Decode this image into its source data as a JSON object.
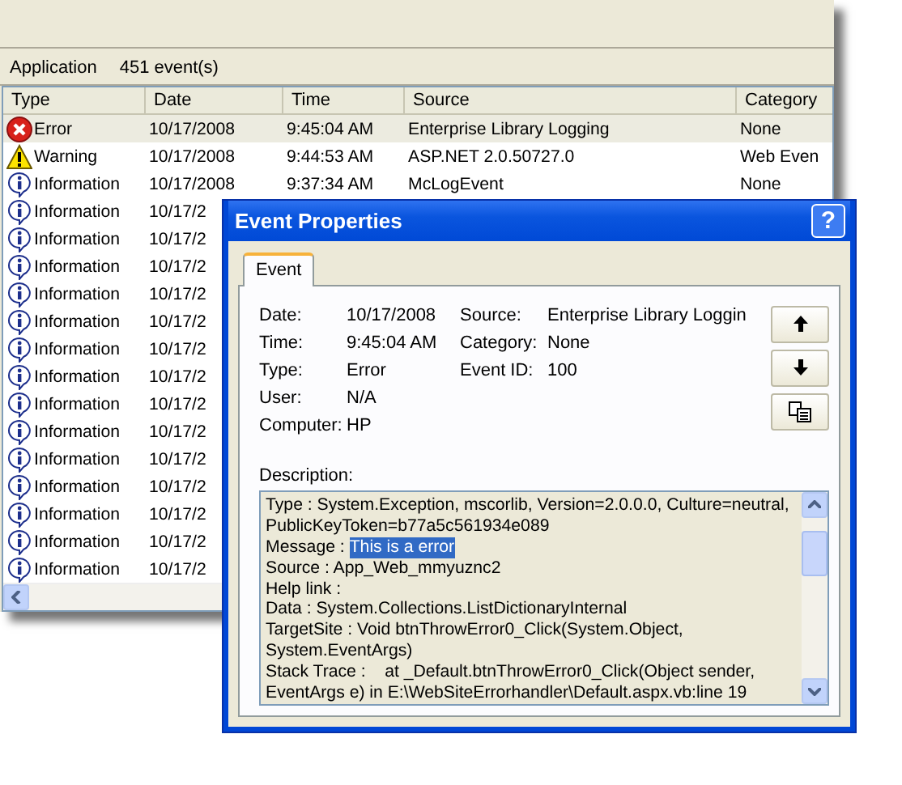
{
  "list_header": {
    "log": "Application",
    "count": "451 event(s)"
  },
  "table": {
    "columns": [
      "Type",
      "Date",
      "Time",
      "Source",
      "Category"
    ],
    "rows": [
      {
        "kind": "error",
        "selected": true,
        "cells": [
          "Error",
          "10/17/2008",
          "9:45:04 AM",
          "Enterprise Library Logging",
          "None"
        ]
      },
      {
        "kind": "warning",
        "selected": false,
        "cells": [
          "Warning",
          "10/17/2008",
          "9:44:53 AM",
          "ASP.NET 2.0.50727.0",
          "Web Even"
        ]
      },
      {
        "kind": "information",
        "selected": false,
        "cells": [
          "Information",
          "10/17/2008",
          "9:37:34 AM",
          "McLogEvent",
          "None"
        ]
      },
      {
        "kind": "information",
        "selected": false,
        "cells": [
          "Information",
          "10/17/2"
        ]
      },
      {
        "kind": "information",
        "selected": false,
        "cells": [
          "Information",
          "10/17/2"
        ]
      },
      {
        "kind": "information",
        "selected": false,
        "cells": [
          "Information",
          "10/17/2"
        ]
      },
      {
        "kind": "information",
        "selected": false,
        "cells": [
          "Information",
          "10/17/2"
        ]
      },
      {
        "kind": "information",
        "selected": false,
        "cells": [
          "Information",
          "10/17/2"
        ]
      },
      {
        "kind": "information",
        "selected": false,
        "cells": [
          "Information",
          "10/17/2"
        ]
      },
      {
        "kind": "information",
        "selected": false,
        "cells": [
          "Information",
          "10/17/2"
        ]
      },
      {
        "kind": "information",
        "selected": false,
        "cells": [
          "Information",
          "10/17/2"
        ]
      },
      {
        "kind": "information",
        "selected": false,
        "cells": [
          "Information",
          "10/17/2"
        ]
      },
      {
        "kind": "information",
        "selected": false,
        "cells": [
          "Information",
          "10/17/2"
        ]
      },
      {
        "kind": "information",
        "selected": false,
        "cells": [
          "Information",
          "10/17/2"
        ]
      },
      {
        "kind": "information",
        "selected": false,
        "cells": [
          "Information",
          "10/17/2"
        ]
      },
      {
        "kind": "information",
        "selected": false,
        "cells": [
          "Information",
          "10/17/2"
        ]
      },
      {
        "kind": "information",
        "selected": false,
        "cells": [
          "Information",
          "10/17/2"
        ]
      }
    ]
  },
  "dialog": {
    "title": "Event Properties",
    "help": "?",
    "tabs": [
      {
        "label": "Event",
        "selected": true
      }
    ],
    "fields_left": [
      {
        "label": "Date:",
        "value": "10/17/2008"
      },
      {
        "label": "Time:",
        "value": "9:45:04 AM"
      },
      {
        "label": "Type:",
        "value": "Error"
      },
      {
        "label": "User:",
        "value": "N/A"
      },
      {
        "label": "Computer:",
        "value": "HP"
      }
    ],
    "fields_right": [
      {
        "label": "Source:",
        "value": "Enterprise Library Loggin"
      },
      {
        "label": "Category:",
        "value": "None"
      },
      {
        "label": "Event ID:",
        "value": "100"
      }
    ],
    "buttons": [
      {
        "kind": "up"
      },
      {
        "kind": "down"
      },
      {
        "kind": "copy"
      }
    ],
    "description_label": "Description:",
    "description_lines": [
      {
        "text": "Type : System.Exception, mscorlib, Version=2.0.0.0, Culture=neutral,"
      },
      {
        "text": "PublicKeyToken=b77a5c561934e089"
      },
      {
        "text": "Message : ",
        "selection": "This is a error"
      },
      {
        "text": "Source : App_Web_mmyuznc2"
      },
      {
        "text": "Help link :"
      },
      {
        "text": "Data : System.Collections.ListDictionaryInternal"
      },
      {
        "text": "TargetSite : Void btnThrowError0_Click(System.Object,"
      },
      {
        "text": "System.EventArgs)"
      },
      {
        "text": "Stack Trace :    at _Default.btnThrowError0_Click(Object sender,"
      },
      {
        "text": "EventArgs e) in E:\\WebSiteErrorhandler\\Default.aspx.vb:line 19"
      }
    ]
  }
}
